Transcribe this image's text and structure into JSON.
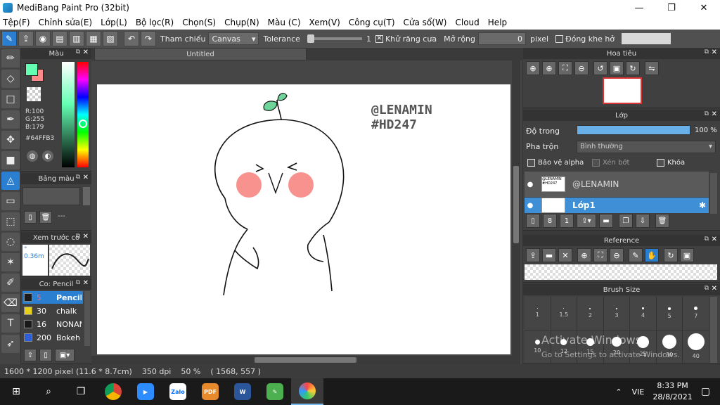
{
  "window": {
    "title": "MediBang Paint Pro (32bit)",
    "minimize": "—",
    "maximize": "❐",
    "close": "✕"
  },
  "menu": [
    "Tệp(F)",
    "Chỉnh sửa(E)",
    "Lớp(L)",
    "Bộ lọc(R)",
    "Chọn(S)",
    "Chụp(N)",
    "Màu (C)",
    "Xem(V)",
    "Công cụ(T)",
    "Cửa sổ(W)",
    "Cloud",
    "Help"
  ],
  "toolbar": {
    "reference_label": "Tham chiếu",
    "reference_value": "Canvas",
    "tolerance_label": "Tolerance",
    "tolerance_value": "1",
    "antialias_label": "Khử răng cưa",
    "expand_label": "Mở rộng",
    "expand_value": "0",
    "expand_unit": "pixel",
    "close_gap_label": "Đóng khe hở"
  },
  "color_panel": {
    "title": "Màu",
    "r": "R:100",
    "g": "G:255",
    "b": "B:179",
    "hex": "#64FFB3",
    "main_color": "#64FFB3",
    "sub_color": "#FF8A8A"
  },
  "palette_panel": {
    "title": "Bảng màu",
    "dashes": "---"
  },
  "preview_panel": {
    "title": "Xem trước co",
    "size": "° 0.36m"
  },
  "brush_panel": {
    "title": "Co: Pencil",
    "brushes": [
      {
        "size": "5",
        "name": "Pencil",
        "color": "#1a1a1a"
      },
      {
        "size": "30",
        "name": "chalk",
        "color": "#e6d21a"
      },
      {
        "size": "16",
        "name": "NONAME",
        "color": "#1a1a1a"
      },
      {
        "size": "200",
        "name": "Bokeh",
        "color": "#2b5fd9"
      }
    ]
  },
  "canvas": {
    "tab_title": "Untitled",
    "watermark_line1": "@LENAMIN",
    "watermark_line2": "#HD247"
  },
  "navigator": {
    "title": "Hoa tiêu"
  },
  "layer_panel": {
    "title": "Lớp",
    "opacity_label": "Độ trong",
    "opacity_value": "100 %",
    "opacity": 1.0,
    "blend_label": "Pha trộn",
    "blend_value": "Bình thường",
    "protect_alpha": "Bảo vệ alpha",
    "clipping": "Xén bớt",
    "lock": "Khóa",
    "layers": [
      {
        "name": "@LENAMIN",
        "thumb_text": "@LENAMIN #HD247",
        "selected": false
      },
      {
        "name": "Lớp1",
        "selected": true
      }
    ]
  },
  "reference_panel": {
    "title": "Reference"
  },
  "brush_size_panel": {
    "title": "Brush Size",
    "sizes": [
      "1",
      "1.5",
      "2",
      "3",
      "4",
      "5",
      "7",
      "10",
      "12",
      "15",
      "20",
      "25",
      "30",
      "40"
    ]
  },
  "windows_watermark": {
    "title": "Activate Windows",
    "subtitle": "Go to Settings to activate Windows."
  },
  "status": {
    "dimensions": "1600 * 1200 pixel",
    "physical": "(11.6 * 8.7cm)",
    "dpi": "350 dpi",
    "zoom": "50 %",
    "cursor": "( 1568, 557 )"
  },
  "taskbar": {
    "lang": "VIE",
    "time": "8:33 PM",
    "date": "28/8/2021"
  }
}
